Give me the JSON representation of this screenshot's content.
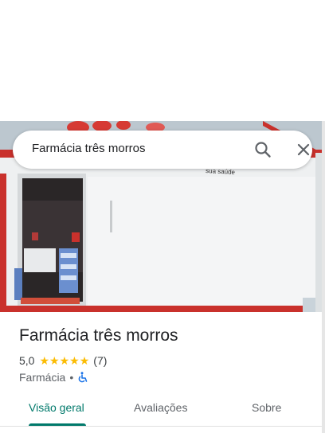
{
  "search": {
    "query": "Farmácia três morros",
    "search_icon": "search-icon",
    "close_icon": "close-icon"
  },
  "place": {
    "title": "Farmácia três morros",
    "rating_value": "5,0",
    "stars": 5,
    "review_count": "(7)",
    "category": "Farmácia",
    "separator": "•",
    "accessibility_icon": "wheelchair-icon",
    "photo_sign_text": "sua saúde"
  },
  "tabs": [
    {
      "label": "Visão geral",
      "active": true
    },
    {
      "label": "Avaliações",
      "active": false
    },
    {
      "label": "Sobre",
      "active": false
    }
  ],
  "colors": {
    "accent": "#00796b",
    "star": "#fbbc04",
    "accessibility": "#1a73e8"
  }
}
